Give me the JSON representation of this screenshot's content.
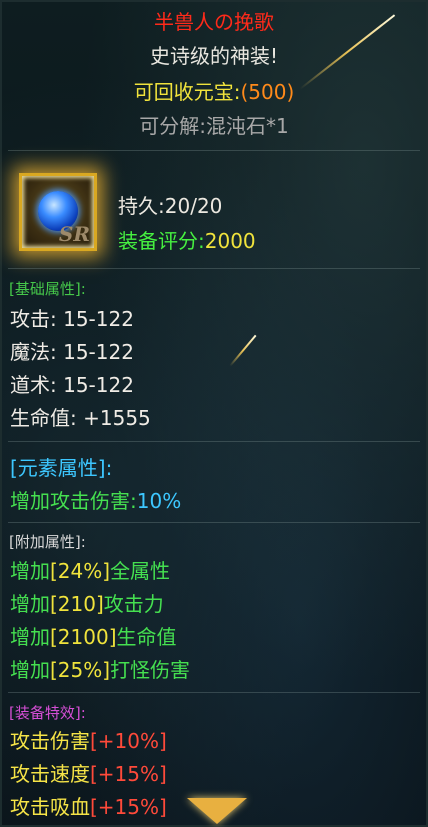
{
  "header": {
    "name": "半兽人の挽歌",
    "grade": "史诗级的神装!",
    "recycle_label": "可回收元宝:",
    "recycle_value": "(500)",
    "dismantle": "可分解:混沌石*1"
  },
  "item": {
    "icon": "blue-orb-gem-icon",
    "badge": "SR",
    "durability_label": "持久:",
    "durability_value": "20/20",
    "score_label": "装备评分:",
    "score_value": "2000"
  },
  "basic": {
    "header": "[基础属性]:",
    "stats": [
      {
        "label": "攻击:",
        "value": "15-122"
      },
      {
        "label": "魔法:",
        "value": "15-122"
      },
      {
        "label": "道术:",
        "value": "15-122"
      },
      {
        "label": "生命值:",
        "value": "+1555"
      }
    ]
  },
  "element": {
    "header": "[元素属性]:",
    "label": "增加攻击伤害:",
    "value": "10%"
  },
  "additional": {
    "header": "[附加属性]:",
    "items": [
      {
        "prefix": "增加",
        "value": "[24%]",
        "suffix": "全属性"
      },
      {
        "prefix": "增加",
        "value": "[210]",
        "suffix": "攻击力"
      },
      {
        "prefix": "增加",
        "value": "[2100]",
        "suffix": "生命值"
      },
      {
        "prefix": "增加",
        "value": "[25%]",
        "suffix": "打怪伤害"
      }
    ]
  },
  "effects": {
    "header": "[装备特效]:",
    "items": [
      {
        "label": "攻击伤害",
        "value": "[+10%]"
      },
      {
        "label": "攻击速度",
        "value": "[+15%]"
      },
      {
        "label": "攻击吸血",
        "value": "[+15%]"
      }
    ]
  },
  "colors": {
    "name": "#ff2a1a",
    "recycle": "#f0e33c",
    "green": "#45e050",
    "cyan": "#3dc7ff",
    "red_bracket": "#ff4a3a",
    "frame_gold": "#d9a821"
  }
}
